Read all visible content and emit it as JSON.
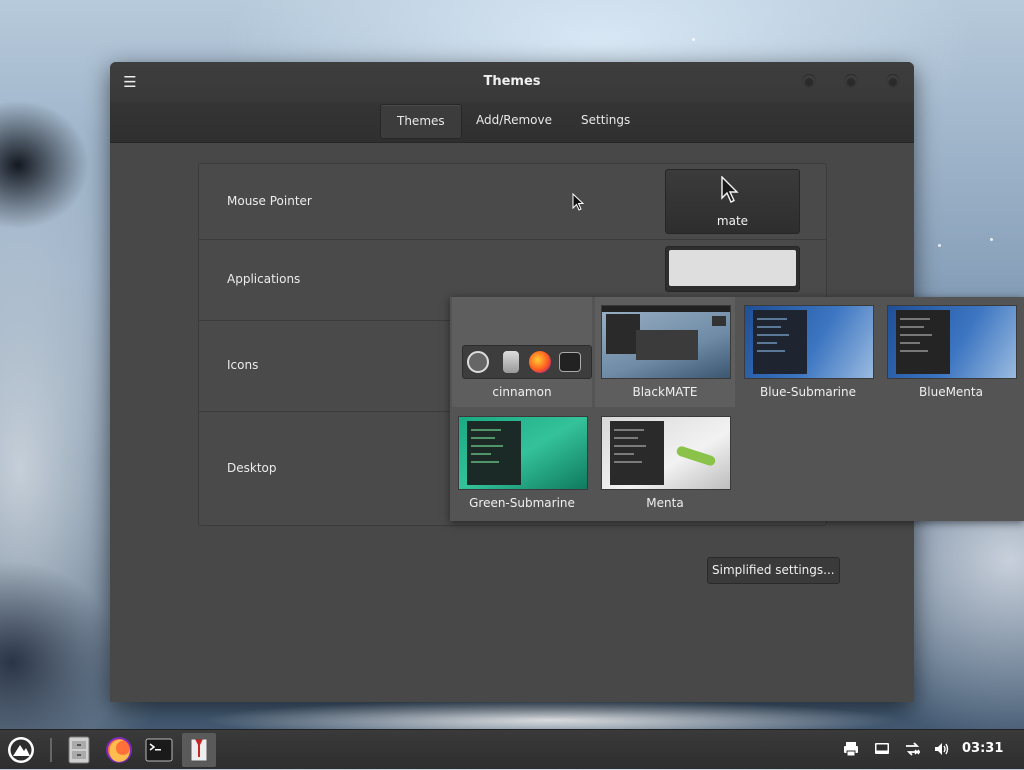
{
  "window": {
    "title": "Themes",
    "menu_icon": "hamburger-menu-icon",
    "tabs": [
      {
        "label": "Themes",
        "active": true
      },
      {
        "label": "Add/Remove",
        "active": false
      },
      {
        "label": "Settings",
        "active": false
      }
    ]
  },
  "settings": {
    "mouse_pointer": {
      "label": "Mouse Pointer",
      "value": "mate"
    },
    "applications": {
      "label": "Applications"
    },
    "icons": {
      "label": "Icons"
    },
    "desktop": {
      "label": "Desktop"
    }
  },
  "simplified_button": "Simplified settings...",
  "theme_popup": {
    "items": [
      {
        "name": "cinnamon",
        "selected": true
      },
      {
        "name": "BlackMATE",
        "selected": true
      },
      {
        "name": "Blue-Submarine",
        "selected": false
      },
      {
        "name": "BlueMenta",
        "selected": false
      },
      {
        "name": "Green-Submarine",
        "selected": false
      },
      {
        "name": "Menta",
        "selected": false
      }
    ]
  },
  "taskbar": {
    "apps": [
      "menu-icon",
      "files-icon",
      "firefox-icon",
      "terminal-icon",
      "themes-app-icon"
    ],
    "tray": [
      "printer-icon",
      "display-icon",
      "network-icon",
      "volume-icon"
    ],
    "clock": "03:31"
  },
  "colors": {
    "window_bg": "#484848",
    "titlebar": "#3e3e3e",
    "taskbar": "#2e2e2e"
  }
}
